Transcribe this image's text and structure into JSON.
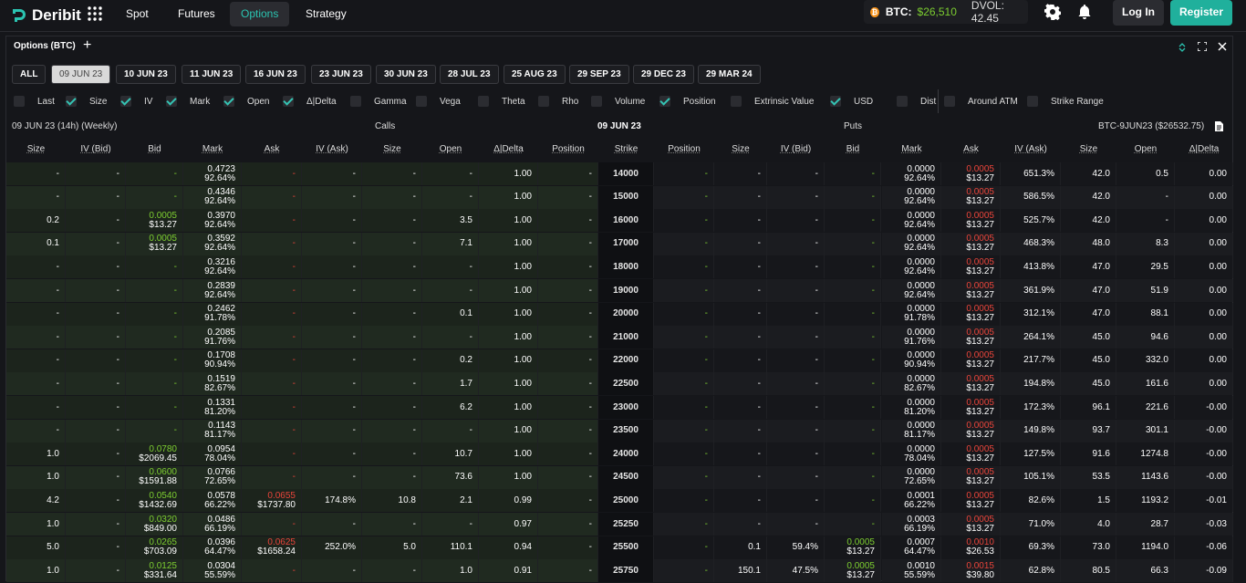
{
  "nav": {
    "brand": "Deribit",
    "items": [
      "Spot",
      "Futures",
      "Options",
      "Strategy"
    ],
    "active": "Options"
  },
  "ticker": {
    "label": "BTC:",
    "price": "$26,510",
    "dvol": "DVOL: 42.45"
  },
  "auth": {
    "login": "Log In",
    "register": "Register"
  },
  "panel": {
    "title": "Options (BTC)",
    "plus": "+"
  },
  "expiries": [
    "ALL",
    "09 JUN 23",
    "10 JUN 23",
    "11 JUN 23",
    "16 JUN 23",
    "23 JUN 23",
    "30 JUN 23",
    "28 JUL 23",
    "25 AUG 23",
    "29 SEP 23",
    "29 DEC 23",
    "29 MAR 24"
  ],
  "selected_expiry": "09 JUN 23",
  "columns_toggle": [
    {
      "label": "Last",
      "on": false
    },
    {
      "label": "Size",
      "on": true
    },
    {
      "label": "IV",
      "on": true
    },
    {
      "label": "Mark",
      "on": true
    },
    {
      "label": "Open",
      "on": true
    },
    {
      "label": "Δ|Delta",
      "on": true
    },
    {
      "label": "Gamma",
      "on": false
    },
    {
      "label": "Vega",
      "on": false
    },
    {
      "label": "Theta",
      "on": false
    },
    {
      "label": "Rho",
      "on": false
    },
    {
      "label": "Volume",
      "on": false
    },
    {
      "label": "Position",
      "on": true
    },
    {
      "label": "Extrinsic Value",
      "on": false
    },
    {
      "label": "USD",
      "on": true
    },
    {
      "label": "Dist",
      "on": false
    },
    {
      "label": "Around ATM",
      "on": false
    },
    {
      "label": "Strike Range",
      "on": false
    }
  ],
  "info": {
    "left": "09 JUN 23 (14h) (Weekly)",
    "calls": "Calls",
    "center": "09 JUN 23",
    "puts": "Puts",
    "right": "BTC-9JUN23 ($26532.75)"
  },
  "headers": {
    "calls": [
      "Size",
      "IV (Bid)",
      "Bid",
      "Mark",
      "Ask",
      "IV (Ask)",
      "Size",
      "Open",
      "Δ|Delta",
      "Position"
    ],
    "strike": "Strike",
    "puts": [
      "Position",
      "Size",
      "IV (Bid)",
      "Bid",
      "Mark",
      "Ask",
      "IV (Ask)",
      "Size",
      "Open",
      "Δ|Delta"
    ]
  },
  "rows": [
    {
      "strike": "14000",
      "c": [
        "-",
        "-",
        [
          "-",
          ""
        ],
        [
          "0.4723",
          "92.64%"
        ],
        [
          "-",
          ""
        ],
        "-",
        "-",
        "-",
        "1.00",
        "-"
      ],
      "p": [
        "-",
        "-",
        "-",
        [
          "-",
          ""
        ],
        [
          "0.0000",
          "92.64%"
        ],
        [
          "0.0005",
          "$13.27"
        ],
        "651.3%",
        "42.0",
        "0.5",
        "0.00"
      ]
    },
    {
      "strike": "15000",
      "c": [
        "-",
        "-",
        [
          "-",
          ""
        ],
        [
          "0.4346",
          "92.64%"
        ],
        [
          "-",
          ""
        ],
        "-",
        "-",
        "-",
        "1.00",
        "-"
      ],
      "p": [
        "-",
        "-",
        "-",
        [
          "-",
          ""
        ],
        [
          "0.0000",
          "92.64%"
        ],
        [
          "0.0005",
          "$13.27"
        ],
        "586.5%",
        "42.0",
        "-",
        "0.00"
      ]
    },
    {
      "strike": "16000",
      "c": [
        "0.2",
        "-",
        [
          "0.0005",
          "$13.27"
        ],
        [
          "0.3970",
          "92.64%"
        ],
        [
          "-",
          ""
        ],
        "-",
        "-",
        "3.5",
        "1.00",
        "-"
      ],
      "p": [
        "-",
        "-",
        "-",
        [
          "-",
          ""
        ],
        [
          "0.0000",
          "92.64%"
        ],
        [
          "0.0005",
          "$13.27"
        ],
        "525.7%",
        "42.0",
        "-",
        "0.00"
      ]
    },
    {
      "strike": "17000",
      "c": [
        "0.1",
        "-",
        [
          "0.0005",
          "$13.27"
        ],
        [
          "0.3592",
          "92.64%"
        ],
        [
          "-",
          ""
        ],
        "-",
        "-",
        "7.1",
        "1.00",
        "-"
      ],
      "p": [
        "-",
        "-",
        "-",
        [
          "-",
          ""
        ],
        [
          "0.0000",
          "92.64%"
        ],
        [
          "0.0005",
          "$13.27"
        ],
        "468.3%",
        "48.0",
        "8.3",
        "0.00"
      ]
    },
    {
      "strike": "18000",
      "c": [
        "-",
        "-",
        [
          "-",
          ""
        ],
        [
          "0.3216",
          "92.64%"
        ],
        [
          "-",
          ""
        ],
        "-",
        "-",
        "-",
        "1.00",
        "-"
      ],
      "p": [
        "-",
        "-",
        "-",
        [
          "-",
          ""
        ],
        [
          "0.0000",
          "92.64%"
        ],
        [
          "0.0005",
          "$13.27"
        ],
        "413.8%",
        "47.0",
        "29.5",
        "0.00"
      ]
    },
    {
      "strike": "19000",
      "c": [
        "-",
        "-",
        [
          "-",
          ""
        ],
        [
          "0.2839",
          "92.64%"
        ],
        [
          "-",
          ""
        ],
        "-",
        "-",
        "-",
        "1.00",
        "-"
      ],
      "p": [
        "-",
        "-",
        "-",
        [
          "-",
          ""
        ],
        [
          "0.0000",
          "92.64%"
        ],
        [
          "0.0005",
          "$13.27"
        ],
        "361.9%",
        "47.0",
        "51.9",
        "0.00"
      ]
    },
    {
      "strike": "20000",
      "c": [
        "-",
        "-",
        [
          "-",
          ""
        ],
        [
          "0.2462",
          "91.78%"
        ],
        [
          "-",
          ""
        ],
        "-",
        "-",
        "0.1",
        "1.00",
        "-"
      ],
      "p": [
        "-",
        "-",
        "-",
        [
          "-",
          ""
        ],
        [
          "0.0000",
          "91.78%"
        ],
        [
          "0.0005",
          "$13.27"
        ],
        "312.1%",
        "47.0",
        "88.1",
        "0.00"
      ]
    },
    {
      "strike": "21000",
      "c": [
        "-",
        "-",
        [
          "-",
          ""
        ],
        [
          "0.2085",
          "91.76%"
        ],
        [
          "-",
          ""
        ],
        "-",
        "-",
        "-",
        "1.00",
        "-"
      ],
      "p": [
        "-",
        "-",
        "-",
        [
          "-",
          ""
        ],
        [
          "0.0000",
          "91.76%"
        ],
        [
          "0.0005",
          "$13.27"
        ],
        "264.1%",
        "45.0",
        "94.6",
        "0.00"
      ]
    },
    {
      "strike": "22000",
      "c": [
        "-",
        "-",
        [
          "-",
          ""
        ],
        [
          "0.1708",
          "90.94%"
        ],
        [
          "-",
          ""
        ],
        "-",
        "-",
        "0.2",
        "1.00",
        "-"
      ],
      "p": [
        "-",
        "-",
        "-",
        [
          "-",
          ""
        ],
        [
          "0.0000",
          "90.94%"
        ],
        [
          "0.0005",
          "$13.27"
        ],
        "217.7%",
        "45.0",
        "332.0",
        "0.00"
      ]
    },
    {
      "strike": "22500",
      "c": [
        "-",
        "-",
        [
          "-",
          ""
        ],
        [
          "0.1519",
          "82.67%"
        ],
        [
          "-",
          ""
        ],
        "-",
        "-",
        "1.7",
        "1.00",
        "-"
      ],
      "p": [
        "-",
        "-",
        "-",
        [
          "-",
          ""
        ],
        [
          "0.0000",
          "82.67%"
        ],
        [
          "0.0005",
          "$13.27"
        ],
        "194.8%",
        "45.0",
        "161.6",
        "0.00"
      ]
    },
    {
      "strike": "23000",
      "c": [
        "-",
        "-",
        [
          "-",
          ""
        ],
        [
          "0.1331",
          "81.20%"
        ],
        [
          "-",
          ""
        ],
        "-",
        "-",
        "6.2",
        "1.00",
        "-"
      ],
      "p": [
        "-",
        "-",
        "-",
        [
          "-",
          ""
        ],
        [
          "0.0000",
          "81.20%"
        ],
        [
          "0.0005",
          "$13.27"
        ],
        "172.3%",
        "96.1",
        "221.6",
        "-0.00"
      ]
    },
    {
      "strike": "23500",
      "c": [
        "-",
        "-",
        [
          "-",
          ""
        ],
        [
          "0.1143",
          "81.17%"
        ],
        [
          "-",
          ""
        ],
        "-",
        "-",
        "-",
        "1.00",
        "-"
      ],
      "p": [
        "-",
        "-",
        "-",
        [
          "-",
          ""
        ],
        [
          "0.0000",
          "81.17%"
        ],
        [
          "0.0005",
          "$13.27"
        ],
        "149.8%",
        "93.7",
        "301.1",
        "-0.00"
      ]
    },
    {
      "strike": "24000",
      "c": [
        "1.0",
        "-",
        [
          "0.0780",
          "$2069.45"
        ],
        [
          "0.0954",
          "78.04%"
        ],
        [
          "-",
          ""
        ],
        "-",
        "-",
        "10.7",
        "1.00",
        "-"
      ],
      "p": [
        "-",
        "-",
        "-",
        [
          "-",
          ""
        ],
        [
          "0.0000",
          "78.04%"
        ],
        [
          "0.0005",
          "$13.27"
        ],
        "127.5%",
        "91.6",
        "1274.8",
        "-0.00"
      ]
    },
    {
      "strike": "24500",
      "c": [
        "1.0",
        "-",
        [
          "0.0600",
          "$1591.88"
        ],
        [
          "0.0766",
          "72.65%"
        ],
        [
          "-",
          ""
        ],
        "-",
        "-",
        "73.6",
        "1.00",
        "-"
      ],
      "p": [
        "-",
        "-",
        "-",
        [
          "-",
          ""
        ],
        [
          "0.0000",
          "72.65%"
        ],
        [
          "0.0005",
          "$13.27"
        ],
        "105.1%",
        "53.5",
        "1143.6",
        "-0.00"
      ]
    },
    {
      "strike": "25000",
      "c": [
        "4.2",
        "-",
        [
          "0.0540",
          "$1432.69"
        ],
        [
          "0.0578",
          "66.22%"
        ],
        [
          "0.0655",
          "$1737.80"
        ],
        "174.8%",
        "10.8",
        "2.1",
        "0.99",
        "-"
      ],
      "p": [
        "-",
        "-",
        "-",
        [
          "-",
          ""
        ],
        [
          "0.0001",
          "66.22%"
        ],
        [
          "0.0005",
          "$13.27"
        ],
        "82.6%",
        "1.5",
        "1193.2",
        "-0.01"
      ]
    },
    {
      "strike": "25250",
      "c": [
        "1.0",
        "-",
        [
          "0.0320",
          "$849.00"
        ],
        [
          "0.0486",
          "66.19%"
        ],
        [
          "-",
          ""
        ],
        "-",
        "-",
        "-",
        "0.97",
        "-"
      ],
      "p": [
        "-",
        "-",
        "-",
        [
          "-",
          ""
        ],
        [
          "0.0003",
          "66.19%"
        ],
        [
          "0.0005",
          "$13.27"
        ],
        "71.0%",
        "4.0",
        "28.7",
        "-0.03"
      ]
    },
    {
      "strike": "25500",
      "c": [
        "5.0",
        "-",
        [
          "0.0265",
          "$703.09"
        ],
        [
          "0.0396",
          "64.47%"
        ],
        [
          "0.0625",
          "$1658.24"
        ],
        "252.0%",
        "5.0",
        "110.1",
        "0.94",
        "-"
      ],
      "p": [
        "-",
        "0.1",
        "59.4%",
        [
          "0.0005",
          "$13.27"
        ],
        [
          "0.0007",
          "64.47%"
        ],
        [
          "0.0010",
          "$26.53"
        ],
        "69.3%",
        "73.0",
        "1194.0",
        "-0.06"
      ]
    },
    {
      "strike": "25750",
      "c": [
        "1.0",
        "-",
        [
          "0.0125",
          "$331.64"
        ],
        [
          "0.0304",
          "55.59%"
        ],
        [
          "-",
          ""
        ],
        "-",
        "-",
        "1.0",
        "0.91",
        "-"
      ],
      "p": [
        "-",
        "150.1",
        "47.5%",
        [
          "0.0005",
          "$13.27"
        ],
        [
          "0.0010",
          "55.59%"
        ],
        [
          "0.0015",
          "$39.80"
        ],
        "62.8%",
        "80.5",
        "66.3",
        "-0.09"
      ]
    }
  ],
  "colors": {
    "accent": "#20b09c",
    "green": "#7ccd30",
    "red": "#e8443a",
    "itm": "#1e2a1e",
    "otm": "#17181c"
  }
}
